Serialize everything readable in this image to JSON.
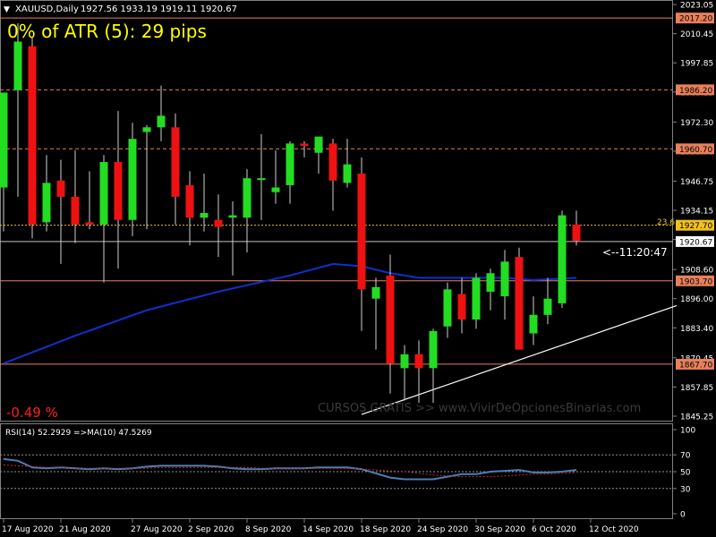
{
  "header": {
    "symbol": "XAUUSD,Daily",
    "ohlc": "1927.56 1933.19 1919.11 1920.67"
  },
  "atr_label": "0% of ATR (5): 29 pips",
  "change_label": "-0.49 %",
  "fib_label": "23.6",
  "countdown_label": "<--11:20:47",
  "watermark": "CURSOS GRATIS >> www.VivirDeOpcionesBinarias.com",
  "rsi_label": "RSI(14) 52.2929  =>MA(10) 47.5269",
  "colors": {
    "bull": "#22dd22",
    "bear": "#ee1111",
    "ma": "#1030d0",
    "level_orange": "#e8805a",
    "level_yellow": "#f0c020",
    "current_price_bg": "#ffffff",
    "rsi": "#4d7fb8",
    "rsi_ma": "#c03030"
  },
  "chart_data": [
    {
      "type": "candlestick",
      "series_name": "XAUUSD Daily",
      "ylim": [
        1845.25,
        2023.05
      ],
      "y_ticks": [
        "2023.05",
        "2010.45",
        "1997.85",
        "1985.25",
        "1972.30",
        "1959.70",
        "1946.75",
        "1934.15",
        "1921.55",
        "1908.60",
        "1896.00",
        "1883.40",
        "1870.45",
        "1857.85",
        "1845.25"
      ],
      "x_labels": [
        "17 Aug 2020",
        "21 Aug 2020",
        "27 Aug 2020",
        "2 Sep 2020",
        "8 Sep 2020",
        "14 Sep 2020",
        "18 Sep 2020",
        "24 Sep 2020",
        "30 Sep 2020",
        "6 Oct 2020",
        "12 Oct 2020"
      ],
      "x_label_index": [
        0,
        4,
        9,
        13,
        17,
        21,
        25,
        29,
        33,
        37,
        41
      ],
      "candles": [
        {
          "o": 1944,
          "h": 1978,
          "l": 1925,
          "c": 1985
        },
        {
          "o": 1986,
          "h": 2015,
          "l": 1940,
          "c": 2007
        },
        {
          "o": 2005,
          "h": 2009,
          "l": 1922,
          "c": 1928
        },
        {
          "o": 1929,
          "h": 1958,
          "l": 1925,
          "c": 1946
        },
        {
          "o": 1947,
          "h": 1956,
          "l": 1911,
          "c": 1940
        },
        {
          "o": 1940,
          "h": 1960,
          "l": 1920,
          "c": 1928
        },
        {
          "o": 1929,
          "h": 1951,
          "l": 1926,
          "c": 1928
        },
        {
          "o": 1928,
          "h": 1958,
          "l": 1903,
          "c": 1955
        },
        {
          "o": 1955,
          "h": 1977,
          "l": 1909,
          "c": 1930
        },
        {
          "o": 1930,
          "h": 1972,
          "l": 1923,
          "c": 1965
        },
        {
          "o": 1968,
          "h": 1971,
          "l": 1926,
          "c": 1970
        },
        {
          "o": 1970,
          "h": 1988,
          "l": 1964,
          "c": 1975
        },
        {
          "o": 1970,
          "h": 1976,
          "l": 1928,
          "c": 1940
        },
        {
          "o": 1945,
          "h": 1951,
          "l": 1919,
          "c": 1931
        },
        {
          "o": 1931,
          "h": 1950,
          "l": 1925,
          "c": 1933
        },
        {
          "o": 1930,
          "h": 1941,
          "l": 1914,
          "c": 1927
        },
        {
          "o": 1931,
          "h": 1938,
          "l": 1906,
          "c": 1932
        },
        {
          "o": 1931,
          "h": 1952,
          "l": 1916,
          "c": 1948
        },
        {
          "o": 1948,
          "h": 1967,
          "l": 1930,
          "c": 1948
        },
        {
          "o": 1942,
          "h": 1960,
          "l": 1937,
          "c": 1944
        },
        {
          "o": 1945,
          "h": 1964,
          "l": 1937,
          "c": 1963
        },
        {
          "o": 1963,
          "h": 1964,
          "l": 1957,
          "c": 1962
        },
        {
          "o": 1959,
          "h": 1965,
          "l": 1950,
          "c": 1966
        },
        {
          "o": 1963,
          "h": 1965,
          "l": 1934,
          "c": 1947
        },
        {
          "o": 1946,
          "h": 1965,
          "l": 1944,
          "c": 1954
        },
        {
          "o": 1950,
          "h": 1957,
          "l": 1882,
          "c": 1900
        },
        {
          "o": 1896,
          "h": 1905,
          "l": 1874,
          "c": 1901
        },
        {
          "o": 1906,
          "h": 1915,
          "l": 1855,
          "c": 1868
        },
        {
          "o": 1866,
          "h": 1876,
          "l": 1852,
          "c": 1872
        },
        {
          "o": 1872,
          "h": 1878,
          "l": 1851,
          "c": 1866
        },
        {
          "o": 1866,
          "h": 1883,
          "l": 1851,
          "c": 1882
        },
        {
          "o": 1884,
          "h": 1903,
          "l": 1879,
          "c": 1900
        },
        {
          "o": 1898,
          "h": 1905,
          "l": 1881,
          "c": 1887
        },
        {
          "o": 1887,
          "h": 1907,
          "l": 1883,
          "c": 1905
        },
        {
          "o": 1899,
          "h": 1909,
          "l": 1891,
          "c": 1907
        },
        {
          "o": 1897,
          "h": 1917,
          "l": 1887,
          "c": 1912
        },
        {
          "o": 1914,
          "h": 1918,
          "l": 1874,
          "c": 1874
        },
        {
          "o": 1881,
          "h": 1897,
          "l": 1876,
          "c": 1889
        },
        {
          "o": 1889,
          "h": 1905,
          "l": 1885,
          "c": 1896
        },
        {
          "o": 1894,
          "h": 1934,
          "l": 1892,
          "c": 1932
        },
        {
          "o": 1928,
          "h": 1934,
          "l": 1919,
          "c": 1921
        }
      ],
      "moving_average": [
        {
          "i": 0,
          "v": 1868
        },
        {
          "i": 5,
          "v": 1880
        },
        {
          "i": 10,
          "v": 1891
        },
        {
          "i": 15,
          "v": 1899
        },
        {
          "i": 20,
          "v": 1906
        },
        {
          "i": 23,
          "v": 1911
        },
        {
          "i": 25,
          "v": 1910
        },
        {
          "i": 27,
          "v": 1907
        },
        {
          "i": 29,
          "v": 1905
        },
        {
          "i": 31,
          "v": 1905
        },
        {
          "i": 33,
          "v": 1905
        },
        {
          "i": 35,
          "v": 1905
        },
        {
          "i": 37,
          "v": 1904
        },
        {
          "i": 40,
          "v": 1905
        }
      ],
      "levels": [
        {
          "price": 2017.2,
          "label": "2017.20",
          "style": "solid",
          "color": "orange"
        },
        {
          "price": 1986.2,
          "label": "1986.20",
          "style": "dashed",
          "color": "orange"
        },
        {
          "price": 1960.7,
          "label": "1960.70",
          "style": "dashed",
          "color": "orange"
        },
        {
          "price": 1927.7,
          "label": "1927.70",
          "style": "dotted",
          "color": "yellow"
        },
        {
          "price": 1903.7,
          "label": "1903.70",
          "style": "solid",
          "color": "orange"
        },
        {
          "price": 1867.7,
          "label": "1867.70",
          "style": "solid",
          "color": "orange"
        }
      ],
      "current_price": {
        "price": 1920.67,
        "label": "1920.67"
      },
      "trendline": {
        "from": {
          "i": 25,
          "p": 1846
        },
        "to": {
          "i": 47,
          "p": 1893
        }
      }
    },
    {
      "type": "line",
      "series_name": "RSI(14)",
      "ylim": [
        0,
        100
      ],
      "y_ticks": [
        100,
        70,
        50,
        30,
        0
      ],
      "levels": [
        70,
        50,
        30
      ],
      "rsi": [
        65,
        63,
        55,
        54,
        55,
        54,
        53,
        54,
        53,
        54,
        56,
        57,
        57,
        57,
        57,
        56,
        54,
        53,
        53,
        54,
        54,
        54,
        55,
        55,
        55,
        53,
        48,
        43,
        41,
        41,
        41,
        44,
        47,
        47,
        50,
        51,
        52,
        49,
        49,
        50,
        52
      ],
      "rsi_ma": [
        58,
        57,
        56,
        55,
        55,
        54,
        54,
        54,
        54,
        54,
        54,
        55,
        55,
        55,
        55,
        55,
        55,
        55,
        54,
        54,
        54,
        54,
        54,
        54,
        54,
        53,
        52,
        51,
        50,
        48,
        46,
        45,
        44,
        44,
        44,
        45,
        46,
        47,
        47,
        48,
        49
      ]
    }
  ]
}
